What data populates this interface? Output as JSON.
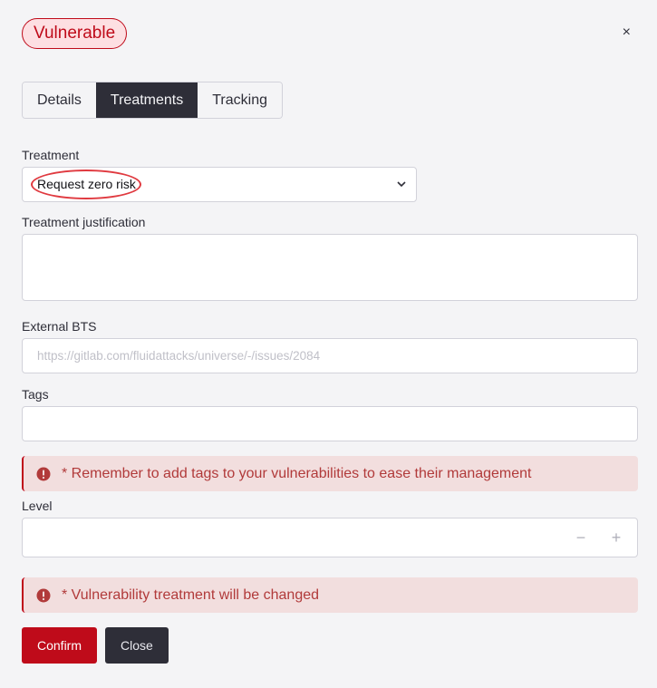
{
  "header": {
    "status_badge": "Vulnerable",
    "close_icon": "×"
  },
  "tabs": [
    {
      "label": "Details",
      "active": false
    },
    {
      "label": "Treatments",
      "active": true
    },
    {
      "label": "Tracking",
      "active": false
    }
  ],
  "form": {
    "treatment": {
      "label": "Treatment",
      "value": "Request zero risk"
    },
    "justification": {
      "label": "Treatment justification",
      "value": ""
    },
    "external_bts": {
      "label": "External BTS",
      "value": "",
      "placeholder": "https://gitlab.com/fluidattacks/universe/-/issues/2084"
    },
    "tags": {
      "label": "Tags",
      "value": ""
    },
    "tags_alert": "* Remember to add tags to your vulnerabilities to ease their management",
    "level": {
      "label": "Level",
      "value": "",
      "decrement": "−",
      "increment": "+"
    },
    "treatment_alert": "* Vulnerability treatment will be changed"
  },
  "actions": {
    "confirm_label": "Confirm",
    "close_label": "Close"
  },
  "colors": {
    "brand_red": "#bf0b1a",
    "dark": "#2e2e38",
    "alert_bg": "#f2dede",
    "alert_text": "#b13a3a"
  }
}
